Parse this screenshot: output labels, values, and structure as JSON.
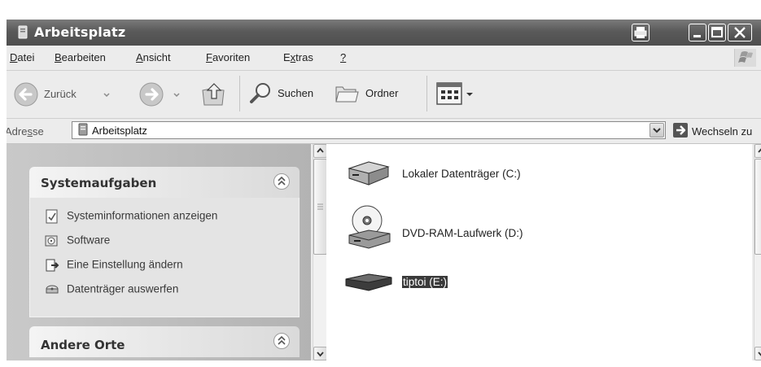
{
  "window": {
    "title": "Arbeitsplatz"
  },
  "menu": [
    {
      "pre": "",
      "key": "D",
      "post": "atei"
    },
    {
      "pre": "",
      "key": "B",
      "post": "earbeiten"
    },
    {
      "pre": "",
      "key": "A",
      "post": "nsicht"
    },
    {
      "pre": "",
      "key": "F",
      "post": "avoriten"
    },
    {
      "pre": "E",
      "key": "x",
      "post": "tras"
    },
    {
      "pre": "",
      "key": "?",
      "post": ""
    }
  ],
  "toolbar": {
    "back_label": "Zurück",
    "search_label": "Suchen",
    "folders_label": "Ordner"
  },
  "address": {
    "label_pre": "Adre",
    "label_key": "s",
    "label_post": "se",
    "value": "Arbeitsplatz",
    "go_label": "Wechseln zu"
  },
  "sidebar": {
    "system_tasks": {
      "title": "Systemaufgaben",
      "items": [
        {
          "label": "Systeminformationen anzeigen",
          "icon": "system-info-icon"
        },
        {
          "label": "Software",
          "icon": "software-icon"
        },
        {
          "label": "Eine Einstellung ändern",
          "icon": "settings-change-icon"
        },
        {
          "label": "Datenträger auswerfen",
          "icon": "eject-icon"
        }
      ]
    },
    "other_places": {
      "title": "Andere Orte"
    }
  },
  "drives": [
    {
      "label": "Lokaler Datenträger (C:)",
      "icon": "hard-disk-icon",
      "selected": false
    },
    {
      "label": "DVD-RAM-Laufwerk (D:)",
      "icon": "dvd-drive-icon",
      "selected": false
    },
    {
      "label": "tiptoi (E:)",
      "icon": "removable-drive-icon",
      "selected": true
    }
  ]
}
